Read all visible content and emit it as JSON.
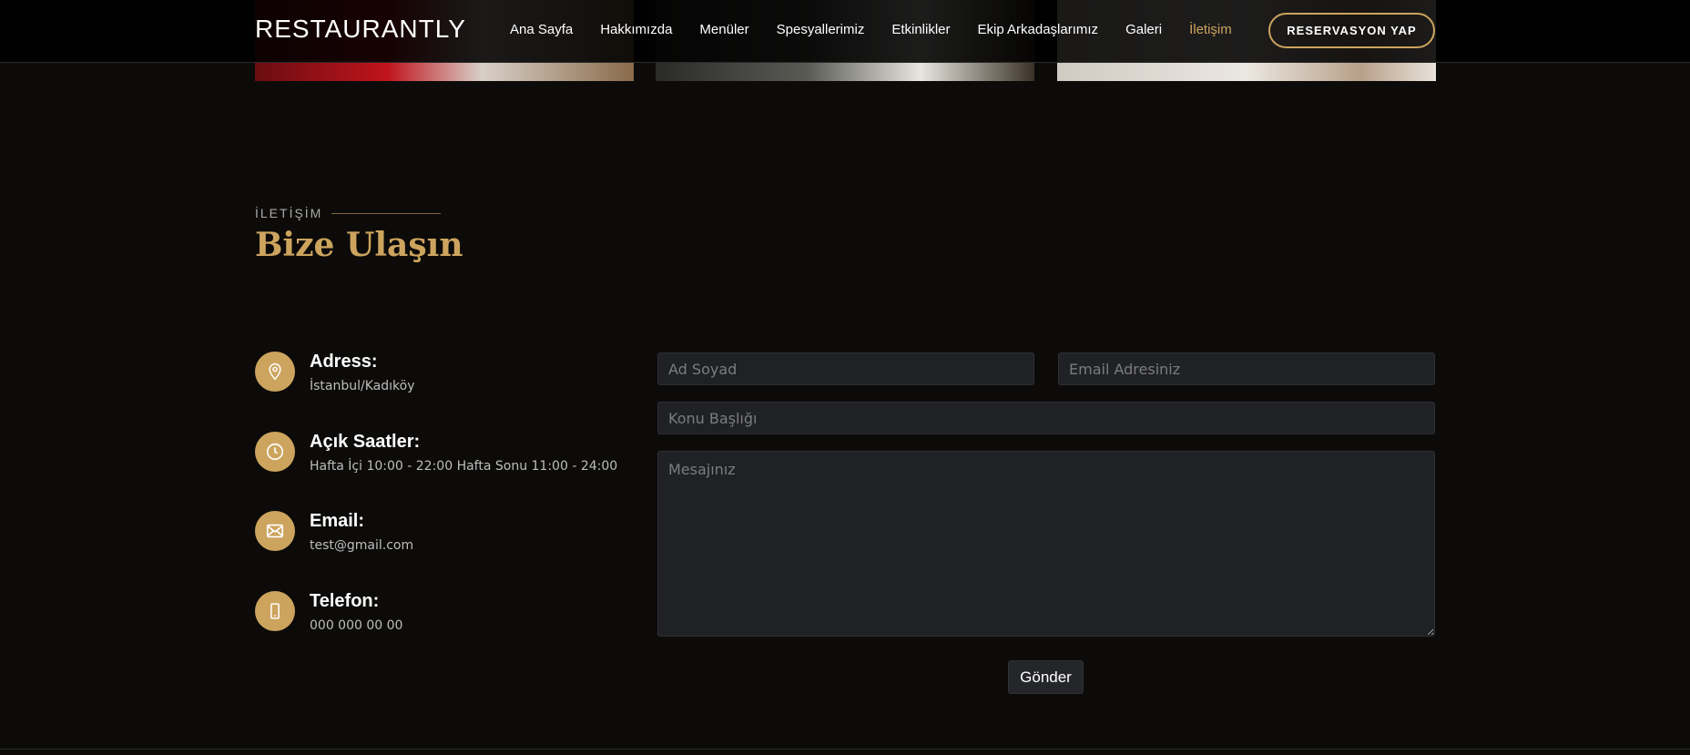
{
  "header": {
    "logo": "RESTAURANTLY",
    "nav": [
      {
        "label": "Ana Sayfa"
      },
      {
        "label": "Hakkımızda"
      },
      {
        "label": "Menüler"
      },
      {
        "label": "Spesyallerimiz"
      },
      {
        "label": "Etkinlikler"
      },
      {
        "label": "Ekip Arkadaşlarımız"
      },
      {
        "label": "Galeri"
      },
      {
        "label": "İletişim",
        "active": true
      }
    ],
    "reserve_label": "RESERVASYON YAP"
  },
  "section": {
    "label": "İLETİŞİM",
    "title": "Bize Ulaşın"
  },
  "info": [
    {
      "icon": "location-pin-icon",
      "title": "Adress:",
      "text": "İstanbul/Kadıköy"
    },
    {
      "icon": "clock-icon",
      "title": "Açık Saatler:",
      "text": "Hafta İçi 10:00 - 22:00 Hafta Sonu 11:00 - 24:00"
    },
    {
      "icon": "envelope-icon",
      "title": "Email:",
      "text": "test@gmail.com"
    },
    {
      "icon": "phone-icon",
      "title": "Telefon:",
      "text": "000 000 00 00"
    }
  ],
  "form": {
    "name_placeholder": "Ad Soyad",
    "email_placeholder": "Email Adresiniz",
    "subject_placeholder": "Konu Başlığı",
    "message_placeholder": "Mesajınız",
    "submit_label": "Gönder"
  },
  "colors": {
    "accent": "#cda45e",
    "background": "#0c0b09",
    "field_bg": "#202125"
  }
}
